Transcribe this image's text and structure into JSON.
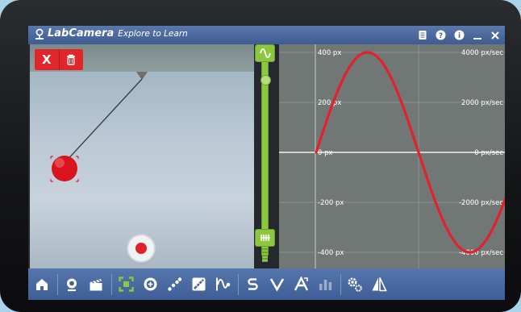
{
  "app": {
    "name": "LabCamera",
    "tagline": "Explore to Learn"
  },
  "camera": {
    "delete_x_label": "X"
  },
  "graph": {
    "left_ticks": [
      "400 px",
      "200 px",
      "0 px",
      "-200 px",
      "-400 px"
    ],
    "right_ticks": [
      "4000 px/sec",
      "2000 px/sec",
      "0 px/sec",
      "-2000 px/sec",
      "-4000 px/sec"
    ],
    "curve_color": "#e3212e"
  },
  "colors": {
    "titlebar": "#4a67a0",
    "accent_green": "#8dc63f",
    "record_red": "#e0202a",
    "delete_red": "#e0252b"
  },
  "toolbar_icons": [
    "home-icon",
    "webcam-icon",
    "clapperboard-icon",
    "select-region-icon",
    "crosshair-icon",
    "tracker-icon",
    "ruler-icon",
    "graph-icon",
    "path-icon",
    "velocity-icon",
    "acceleration-icon",
    "bar-chart-icon",
    "settings-icon",
    "calibrate-icon"
  ]
}
